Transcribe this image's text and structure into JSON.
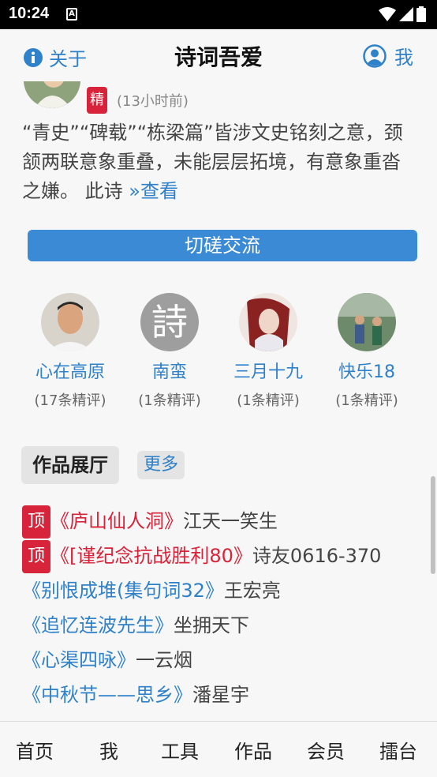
{
  "status": {
    "time": "10:24",
    "notification_glyph": "A"
  },
  "header": {
    "about_label": "关于",
    "title": "诗词吾爱",
    "me_label": "我"
  },
  "review": {
    "badge": "精",
    "time": "(13小时前)",
    "text": "“青史”“碑载”“栋梁篇”皆涉文史铭刻之意，颈颔两联意象重叠，未能层层拓境，有意象重沓之嫌。 此诗 ",
    "more_link": "»查看"
  },
  "exchange_button": "切磋交流",
  "critics": [
    {
      "name": "心在高原",
      "count": "(17条精评)"
    },
    {
      "name": "南蛮",
      "count": "(1条精评)",
      "avatar_glyph": "詩"
    },
    {
      "name": "三月十九",
      "count": "(1条精评)"
    },
    {
      "name": "快乐18",
      "count": "(1条精评)"
    }
  ],
  "works": {
    "heading": "作品展厅",
    "more_label": "更多",
    "items": [
      {
        "pinned": true,
        "pin_label": "顶",
        "title": "《庐山仙人洞》",
        "author": "江天一笑生"
      },
      {
        "pinned": true,
        "pin_label": "顶",
        "title": "《[谨纪念抗战胜利80》",
        "author": "诗友0616-370"
      },
      {
        "pinned": false,
        "title": "《别恨成堆(集句词32》",
        "author": "王宏亮"
      },
      {
        "pinned": false,
        "title": "《追忆连波先生》",
        "author": "坐拥天下"
      },
      {
        "pinned": false,
        "title": "《心渠四咏》",
        "author": "一云烟"
      },
      {
        "pinned": false,
        "title": "《中秋节——思乡》",
        "author": "潘星宇"
      }
    ]
  },
  "nav": [
    "首页",
    "我",
    "工具",
    "作品",
    "会员",
    "擂台"
  ],
  "colors": {
    "accent": "#2f81c9",
    "badge_red": "#d8243a",
    "button_blue": "#3b8ad6"
  }
}
